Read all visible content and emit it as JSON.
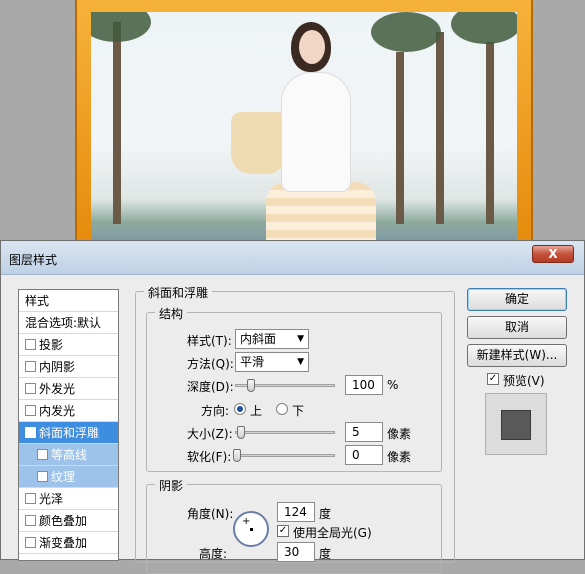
{
  "dialog": {
    "title": "图层样式",
    "close_label": "X"
  },
  "style_list": {
    "header": "样式",
    "blend_options": "混合选项:默认",
    "items": [
      {
        "label": "投影",
        "checked": false
      },
      {
        "label": "内阴影",
        "checked": false
      },
      {
        "label": "外发光",
        "checked": false
      },
      {
        "label": "内发光",
        "checked": false
      },
      {
        "label": "斜面和浮雕",
        "checked": true
      },
      {
        "label": "等高线",
        "checked": false
      },
      {
        "label": "纹理",
        "checked": false
      },
      {
        "label": "光泽",
        "checked": false
      },
      {
        "label": "颜色叠加",
        "checked": false
      },
      {
        "label": "渐变叠加",
        "checked": false
      }
    ]
  },
  "bevel": {
    "section_title": "斜面和浮雕",
    "structure_title": "结构",
    "style_label": "样式(T):",
    "style_value": "内斜面",
    "technique_label": "方法(Q):",
    "technique_value": "平滑",
    "depth_label": "深度(D):",
    "depth_value": "100",
    "depth_unit": "%",
    "direction_label": "方向:",
    "direction_up": "上",
    "direction_down": "下",
    "size_label": "大小(Z):",
    "size_value": "5",
    "size_unit": "像素",
    "soften_label": "软化(F):",
    "soften_value": "0",
    "soften_unit": "像素"
  },
  "shading": {
    "title": "阴影",
    "angle_label": "角度(N):",
    "angle_value": "124",
    "angle_unit": "度",
    "global_light_label": "使用全局光(G)",
    "global_light_checked": true,
    "altitude_label": "高度:",
    "altitude_value": "30",
    "altitude_unit": "度"
  },
  "buttons": {
    "ok": "确定",
    "cancel": "取消",
    "new_style": "新建样式(W)...",
    "preview_label": "预览(V)",
    "preview_checked": true
  },
  "check_mark": "✓"
}
